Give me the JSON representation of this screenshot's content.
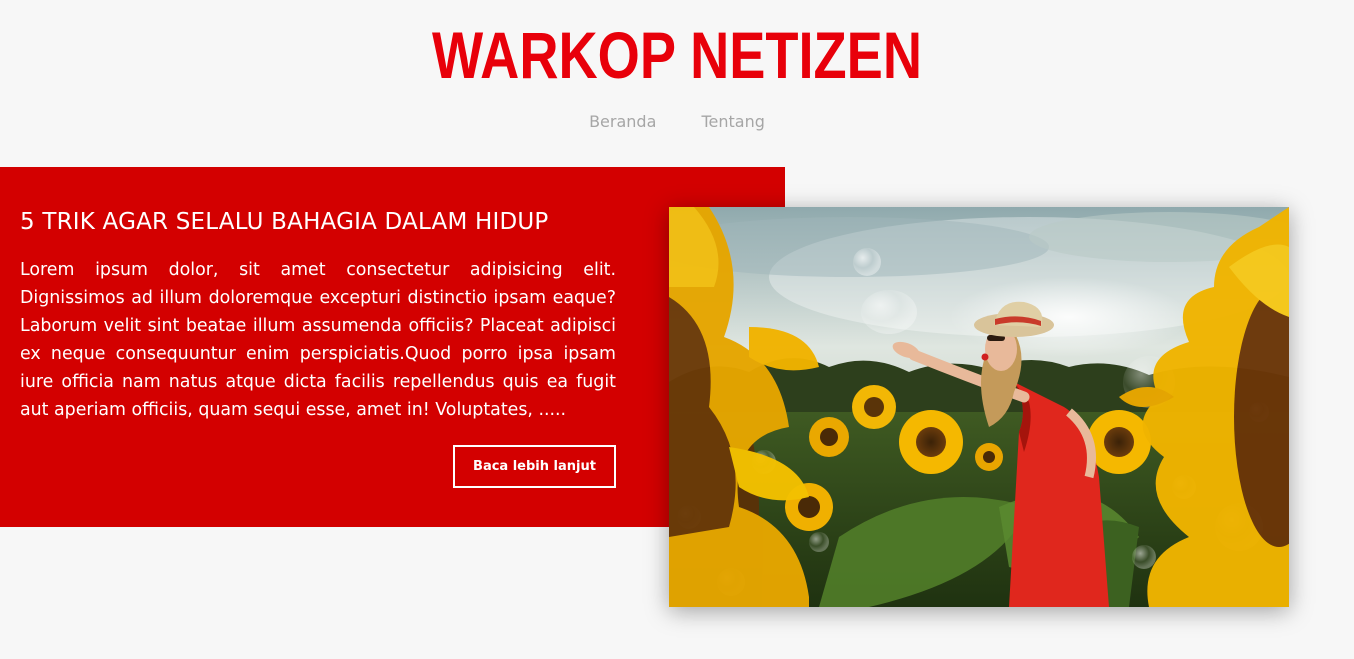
{
  "site": {
    "title": "WARKOP NETIZEN",
    "brand_color": "#e8000a"
  },
  "nav": {
    "items": [
      {
        "label": "Beranda"
      },
      {
        "label": "Tentang"
      }
    ],
    "color": "#a6a6a6"
  },
  "article": {
    "title": "5 TRIK AGAR SELALU BAHAGIA DALAM HIDUP",
    "excerpt": "Lorem ipsum dolor, sit amet consectetur adipisicing elit. Dignissimos ad illum doloremque excepturi distinctio ipsam eaque? Laborum velit sint beatae illum assumenda officiis? Placeat adipisci ex neque consequuntur enim perspiciatis.Quod porro ipsa ipsam iure officia nam natus atque dicta facilis repellendus quis ea fugit aut aperiam officiis, quam sequi esse, amet in! Voluptates, .....",
    "read_more_label": "Baca lebih lanjut",
    "panel_color": "#d30000"
  },
  "image": {
    "subject": "woman-blowing-kiss-in-sunflower-field"
  }
}
